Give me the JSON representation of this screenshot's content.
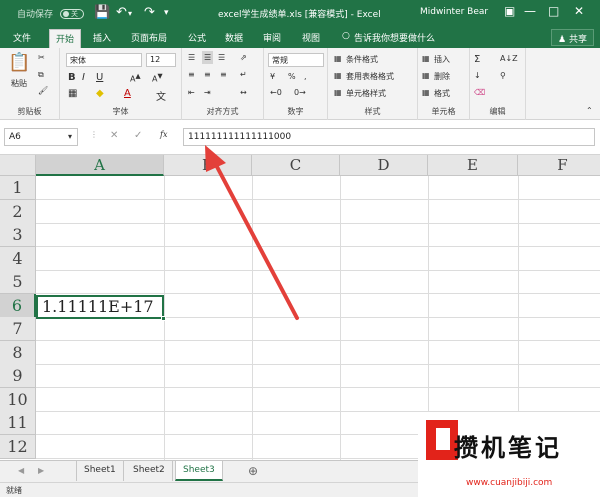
{
  "titlebar": {
    "autosave": "自动保存",
    "autosave_state": "关",
    "title": "excel学生成绩单.xls [兼容模式] - Excel",
    "user": "Midwinter Bear"
  },
  "tabs": [
    "文件",
    "开始",
    "插入",
    "页面布局",
    "公式",
    "数据",
    "审阅",
    "视图"
  ],
  "active_tab": "开始",
  "tell_me": "告诉我你想要做什么",
  "share": "共享",
  "ribbon": {
    "clipboard": {
      "label": "剪贴板",
      "paste": "粘贴"
    },
    "font": {
      "label": "字体",
      "name": "宋体",
      "size": "12",
      "bold": "B",
      "italic": "I",
      "underline": "U"
    },
    "alignment": {
      "label": "对齐方式"
    },
    "number": {
      "label": "数字",
      "format": "常规"
    },
    "styles": {
      "label": "样式",
      "conditional": "条件格式",
      "table": "套用表格格式",
      "cell": "单元格样式"
    },
    "cells": {
      "label": "单元格",
      "insert": "插入",
      "delete": "删除",
      "format": "格式"
    },
    "editing": {
      "label": "编辑"
    }
  },
  "formula_bar": {
    "name_box": "A6",
    "fx": "fx",
    "value": "111111111111111000"
  },
  "columns": [
    "A",
    "B",
    "C",
    "D",
    "E",
    "F"
  ],
  "selected_column": "A",
  "rows": [
    "1",
    "2",
    "3",
    "4",
    "5",
    "6",
    "7",
    "8",
    "9",
    "10",
    "11",
    "12"
  ],
  "selected_row": "6",
  "cells": {
    "A6": "1.11111E+17"
  },
  "sheets": [
    "Sheet1",
    "Sheet2",
    "Sheet3"
  ],
  "active_sheet": "Sheet3",
  "status": "就绪",
  "watermark": {
    "text": "攒机笔记",
    "url": "www.cuanjibiji.com"
  },
  "colors": {
    "excel_green": "#217346",
    "arrow": "#e3403a"
  }
}
